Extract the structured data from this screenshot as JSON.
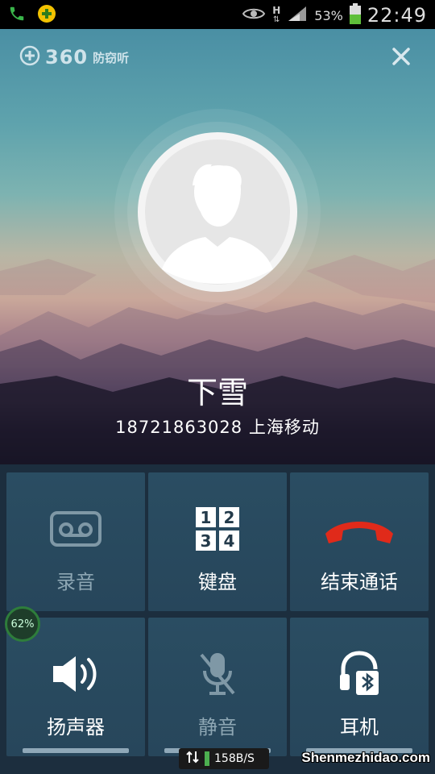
{
  "status_bar": {
    "battery_percent": "53%",
    "time": "22:49",
    "signal_type": "H",
    "icons": [
      "phone-icon",
      "plus-icon",
      "eye-icon",
      "signal-icon",
      "battery-icon"
    ]
  },
  "header": {
    "brand_number": "360",
    "brand_text": "防窃听"
  },
  "caller": {
    "name": "下雪",
    "number_location": "18721863028 上海移动"
  },
  "controls": [
    {
      "label": "录音",
      "icon": "tape-record-icon",
      "enabled": false
    },
    {
      "label": "键盘",
      "icon": "keypad-icon",
      "enabled": true,
      "keys": [
        "1",
        "2",
        "3",
        "4"
      ]
    },
    {
      "label": "结束通话",
      "icon": "end-call-icon",
      "enabled": true
    },
    {
      "label": "扬声器",
      "icon": "speaker-icon",
      "enabled": true
    },
    {
      "label": "静音",
      "icon": "mute-mic-icon",
      "enabled": false
    },
    {
      "label": "耳机",
      "icon": "bluetooth-headset-icon",
      "enabled": true
    }
  ],
  "overlay": {
    "progress": "62%",
    "net_speed": "158B/S"
  },
  "watermark": "Shenmezhidao.com",
  "colors": {
    "end_call_red": "#e02a1a",
    "tile_bg": "#2a4d62",
    "disabled_text": "#8ea7b4"
  }
}
